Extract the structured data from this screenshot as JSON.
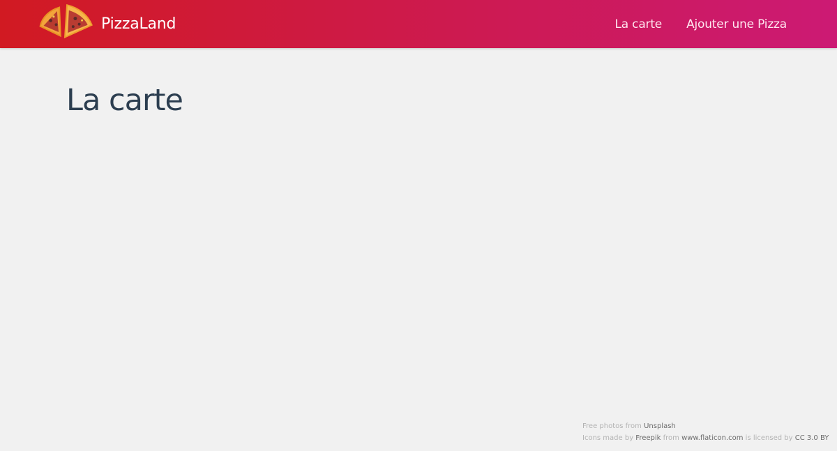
{
  "header": {
    "brand": "PizzaLand",
    "nav": [
      {
        "label": "La carte"
      },
      {
        "label": "Ajouter une Pizza"
      }
    ]
  },
  "main": {
    "title": "La carte"
  },
  "footer": {
    "line1": {
      "prefix": "Free photos from ",
      "link": "Unsplash"
    },
    "line2": {
      "prefix": "Icons made by ",
      "author": "Freepik",
      "from": " from ",
      "site": "www.flaticon.com",
      "licensed": " is licensed by ",
      "license": "CC 3.0 BY"
    }
  }
}
